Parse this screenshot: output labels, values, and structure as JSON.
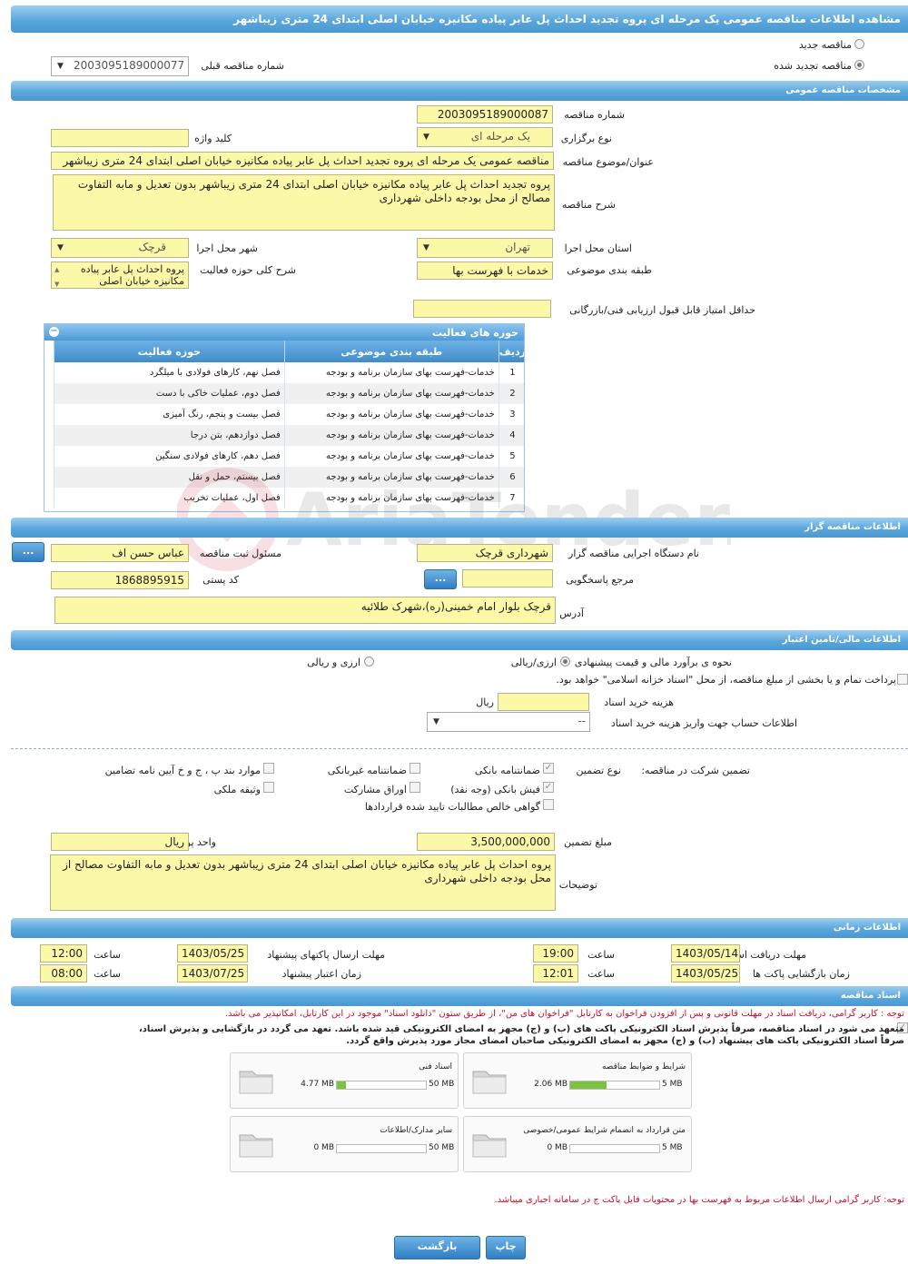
{
  "title": "مشاهده اطلاعات مناقصه عمومی یک مرحله ای پروه تجدید احداث پل عابر پیاده مکانیزه خیابان اصلی ابتدای 24 متری زیباشهر",
  "top": {
    "radio_new": "مناقصه جدید",
    "radio_renewed": "مناقصه تجدید شده",
    "prev_label": "شماره مناقصه قبلی",
    "prev_value": "2003095189000077"
  },
  "general": {
    "header": "مشخصات مناقصه عمومی",
    "number_label": "شماره مناقصه",
    "number_value": "2003095189000087",
    "type_label": "نوع برگزاری",
    "type_value": "یک مرحله ای",
    "keyword_label": "کلید واژه",
    "keyword_value": "",
    "subject_label": "عنوان/موضوع مناقصه",
    "subject_value": "مناقصه عمومی یک مرحله ای پروه تجدید احداث پل عابر پیاده مکانیزه خیابان اصلی ابتدای 24 متری زیباشهر",
    "desc_label": "شرح مناقصه",
    "desc_value": "پروه تجدید احداث پل عابر پیاده مکانیزه خیابان اصلی ابتدای 24 متری زیباشهر بدون تعدیل و مابه التفاوت مصالح از محل بودجه داخلی شهرداری",
    "province_label": "استان محل اجرا",
    "province_value": "تهران",
    "city_label": "شهر محل اجرا",
    "city_value": "قرچک",
    "category_label": "طبقه بندی موضوعی",
    "category_value": "خدمات با فهرست بها",
    "scope_label": "شرح کلی حوزه فعالیت",
    "scope_value": "پروه احداث پل عابر پیاده مکانیزه خیابان اصلی",
    "minscore_label": "حداقل امتیاز قابل قبول ارزیابی فنی/بازرگانی",
    "minscore_value": ""
  },
  "activities": {
    "title": "حوزه های فعالیت",
    "headers": [
      "ردیف",
      "طبقه بندی موضوعی",
      "حوزه فعالیت"
    ],
    "rows": [
      [
        "1",
        "خدمات-فهرست بهای سازمان برنامه و بودجه",
        "فصل نهم، کارهای فولادی با میلگرد"
      ],
      [
        "2",
        "خدمات-فهرست بهای سازمان برنامه و بودجه",
        "فصل دوم، عملیات خاکی با دست"
      ],
      [
        "3",
        "خدمات-فهرست بهای سازمان برنامه و بودجه",
        "فصل بیست و پنجم، رنگ آمیزی"
      ],
      [
        "4",
        "خدمات-فهرست بهای سازمان برنامه و بودجه",
        "فصل دوازدهم، بتن درجا"
      ],
      [
        "5",
        "خدمات-فهرست بهای سازمان برنامه و بودجه",
        "فصل دهم، کارهای فولادی سنگین"
      ],
      [
        "6",
        "خدمات-فهرست بهای سازمان برنامه و بودجه",
        "فصل بیستم، حمل و نقل"
      ],
      [
        "7",
        "خدمات-فهرست بهای سازمان برنامه و بودجه",
        "فصل اول، عملیات تخریب"
      ]
    ]
  },
  "organizer": {
    "header": "اطلاعات مناقصه گزار",
    "org_label": "نام دستگاه اجرایی مناقصه گزار",
    "org_value": "شهرداری قرچک",
    "resp_label": "مسئول ثبت مناقصه",
    "resp_value": "عباس حسن اف",
    "ref_label": "مرجع پاسخگویی",
    "ref_value": "",
    "postal_label": "کد پستی",
    "postal_value": "1868895915",
    "address_label": "آدرس",
    "address_value": "قرچک بلوار امام خمینی(ره)،شهرک طلائیه",
    "more_btn": "..."
  },
  "finance": {
    "header": "اطلاعات مالی/تامین اعتبار",
    "estimate_label": "نحوه ی برآورد مالی و قیمت پیشنهادی",
    "opt_rial": "ارزی/ریالی",
    "opt_fx": "ارزی و ریالی",
    "treasury_text": "پرداخت تمام و یا بخشی از مبلغ مناقصه، از محل \"اسناد خزانه اسلامی\" خواهد بود.",
    "doc_fee_label": "هزینه خرید اسناد",
    "doc_fee_unit": "ریال",
    "account_label": "اطلاعات حساب جهت واریز هزینه خرید اسناد",
    "account_value": "--"
  },
  "guarantee": {
    "label": "تضمین شرکت در مناقصه:",
    "type_label": "نوع تضمین",
    "items": [
      "ضمانتنامه بانکی",
      "ضمانتنامه غیربانکی",
      "موارد بند پ ، ج و خ آیین نامه تضامین",
      "فیش بانکی (وجه نقد)",
      "اوراق مشارکت",
      "وثیقه ملکی",
      "گواهی خالص مطالبات تایید شده قراردادها"
    ],
    "amount_label": "مبلغ تضمین",
    "amount_value": "3,500,000,000",
    "currency_label": "واحد پول",
    "currency_value": "ریال",
    "notes_label": "توضیحات",
    "notes_value": "پروه احداث پل عابر پیاده مکانیزه خیابان اصلی ابتدای 24 متری زیباشهر بدون تعدیل و مابه التفاوت مصالح از محل بودجه داخلی شهرداری"
  },
  "timing": {
    "header": "اطلاعات زمانی",
    "receive_label": "مهلت دریافت اسناد",
    "receive_date": "1403/05/14",
    "receive_time": "19:00",
    "submit_label": "مهلت ارسال پاکتهای پیشنهاد",
    "submit_date": "1403/05/25",
    "submit_time": "12:00",
    "open_label": "زمان بازگشایی پاکت ها",
    "open_date": "1403/05/25",
    "open_time": "12:01",
    "valid_label": "زمان اعتبار پیشنهاد",
    "valid_date": "1403/07/25",
    "valid_time": "08:00",
    "time_label": "ساعت"
  },
  "documents": {
    "header": "اسناد مناقصه",
    "note1": "توجه : کاربر گرامی، دریافت اسناد در مهلت قانونی و پس از افزودن فراخوان به کارتابل \"فراخوان های من\"، از طریق ستون \"دانلود اسناد\" موجود در این کارتابل، امکانپذیر می باشد.",
    "pledge1": "متعهد می شود در اسناد مناقصه، صرفاً پذیرش اسناد الکترونیکی پاکت های (ب) و (ج) مجهز به امضای الکترونیکی قید شده باشد. تعهد می گردد در بازگشایی و پذیرش اسناد،",
    "pledge2": "صرفاً اسناد الکترونیکی پاکت های پیشنهاد (ب) و (ج) مجهز به امضای الکترونیکی صاحبان امضای مجاز مورد پذیرش واقع گردد.",
    "files": [
      {
        "name": "شرایط و ضوابط مناقصه",
        "size": "2.06 MB",
        "max": "5 MB",
        "ratio": 0.41
      },
      {
        "name": "اسناد فنی",
        "size": "4.77 MB",
        "max": "50 MB",
        "ratio": 0.1
      },
      {
        "name": "متن قرارداد به انضمام شرایط عمومی/خصوصی",
        "size": "0 MB",
        "max": "5 MB",
        "ratio": 0
      },
      {
        "name": "سایر مدارک/اطلاعات",
        "size": "0 MB",
        "max": "50 MB",
        "ratio": 0
      }
    ],
    "note2": "توجه: کاربر گرامی ارسال اطلاعات مربوط به فهرست بها در محتویات فایل پاکت ج در سامانه اجباری میباشد."
  },
  "buttons": {
    "print": "چاپ",
    "back": "بازگشت"
  },
  "watermark": "AriaTender.neT",
  "colors": {
    "header": "#5aa7dd",
    "field": "#fbf8a8",
    "note_red": "#c8102e",
    "progress": "#7cc23f"
  }
}
